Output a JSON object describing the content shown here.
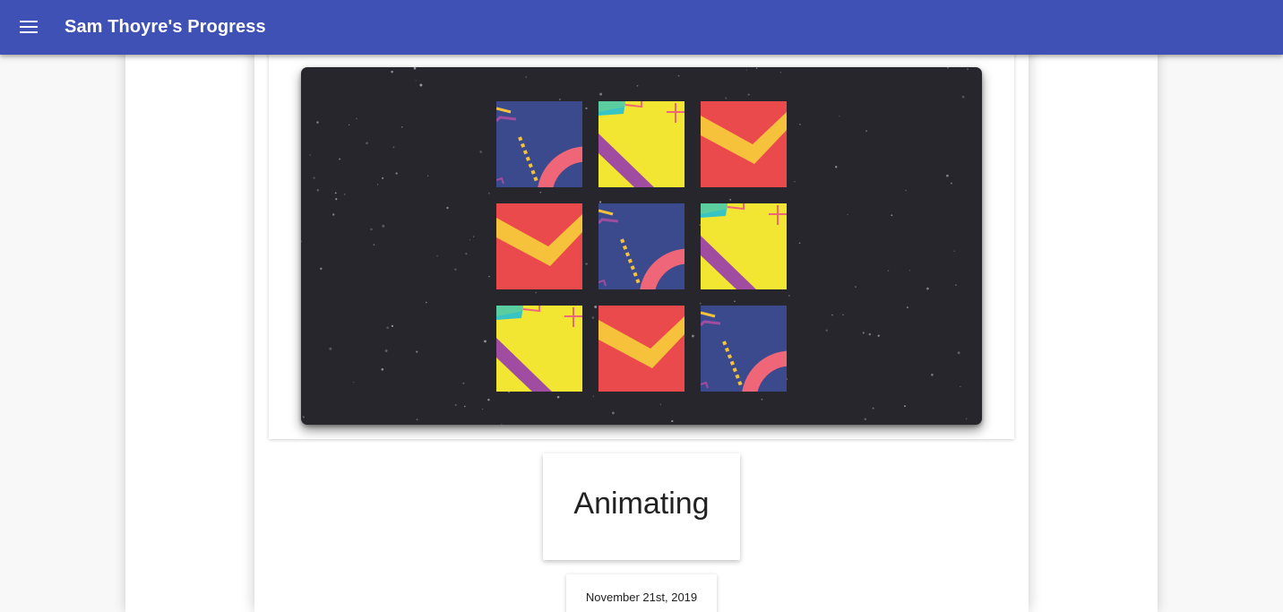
{
  "app_bar": {
    "title": "Sam Thoyre's Progress",
    "menu_icon": "menu-icon",
    "color": "#3f51b5"
  },
  "post": {
    "title": "Animating",
    "date": "November 21st, 2019"
  },
  "artwork": {
    "background": "#27262c",
    "grid": [
      [
        "blue-arc",
        "yellow-stripe",
        "red-chevron"
      ],
      [
        "red-chevron",
        "blue-arc",
        "yellow-stripe"
      ],
      [
        "yellow-stripe",
        "red-chevron",
        "blue-arc"
      ]
    ],
    "colors": {
      "blue": "#3a4a8c",
      "yellow": "#f3e633",
      "red": "#ea4a4c",
      "pink": "#ee6678",
      "orange": "#f6c23c",
      "purple": "#a04ca0",
      "teal": "#39c4c4"
    }
  }
}
